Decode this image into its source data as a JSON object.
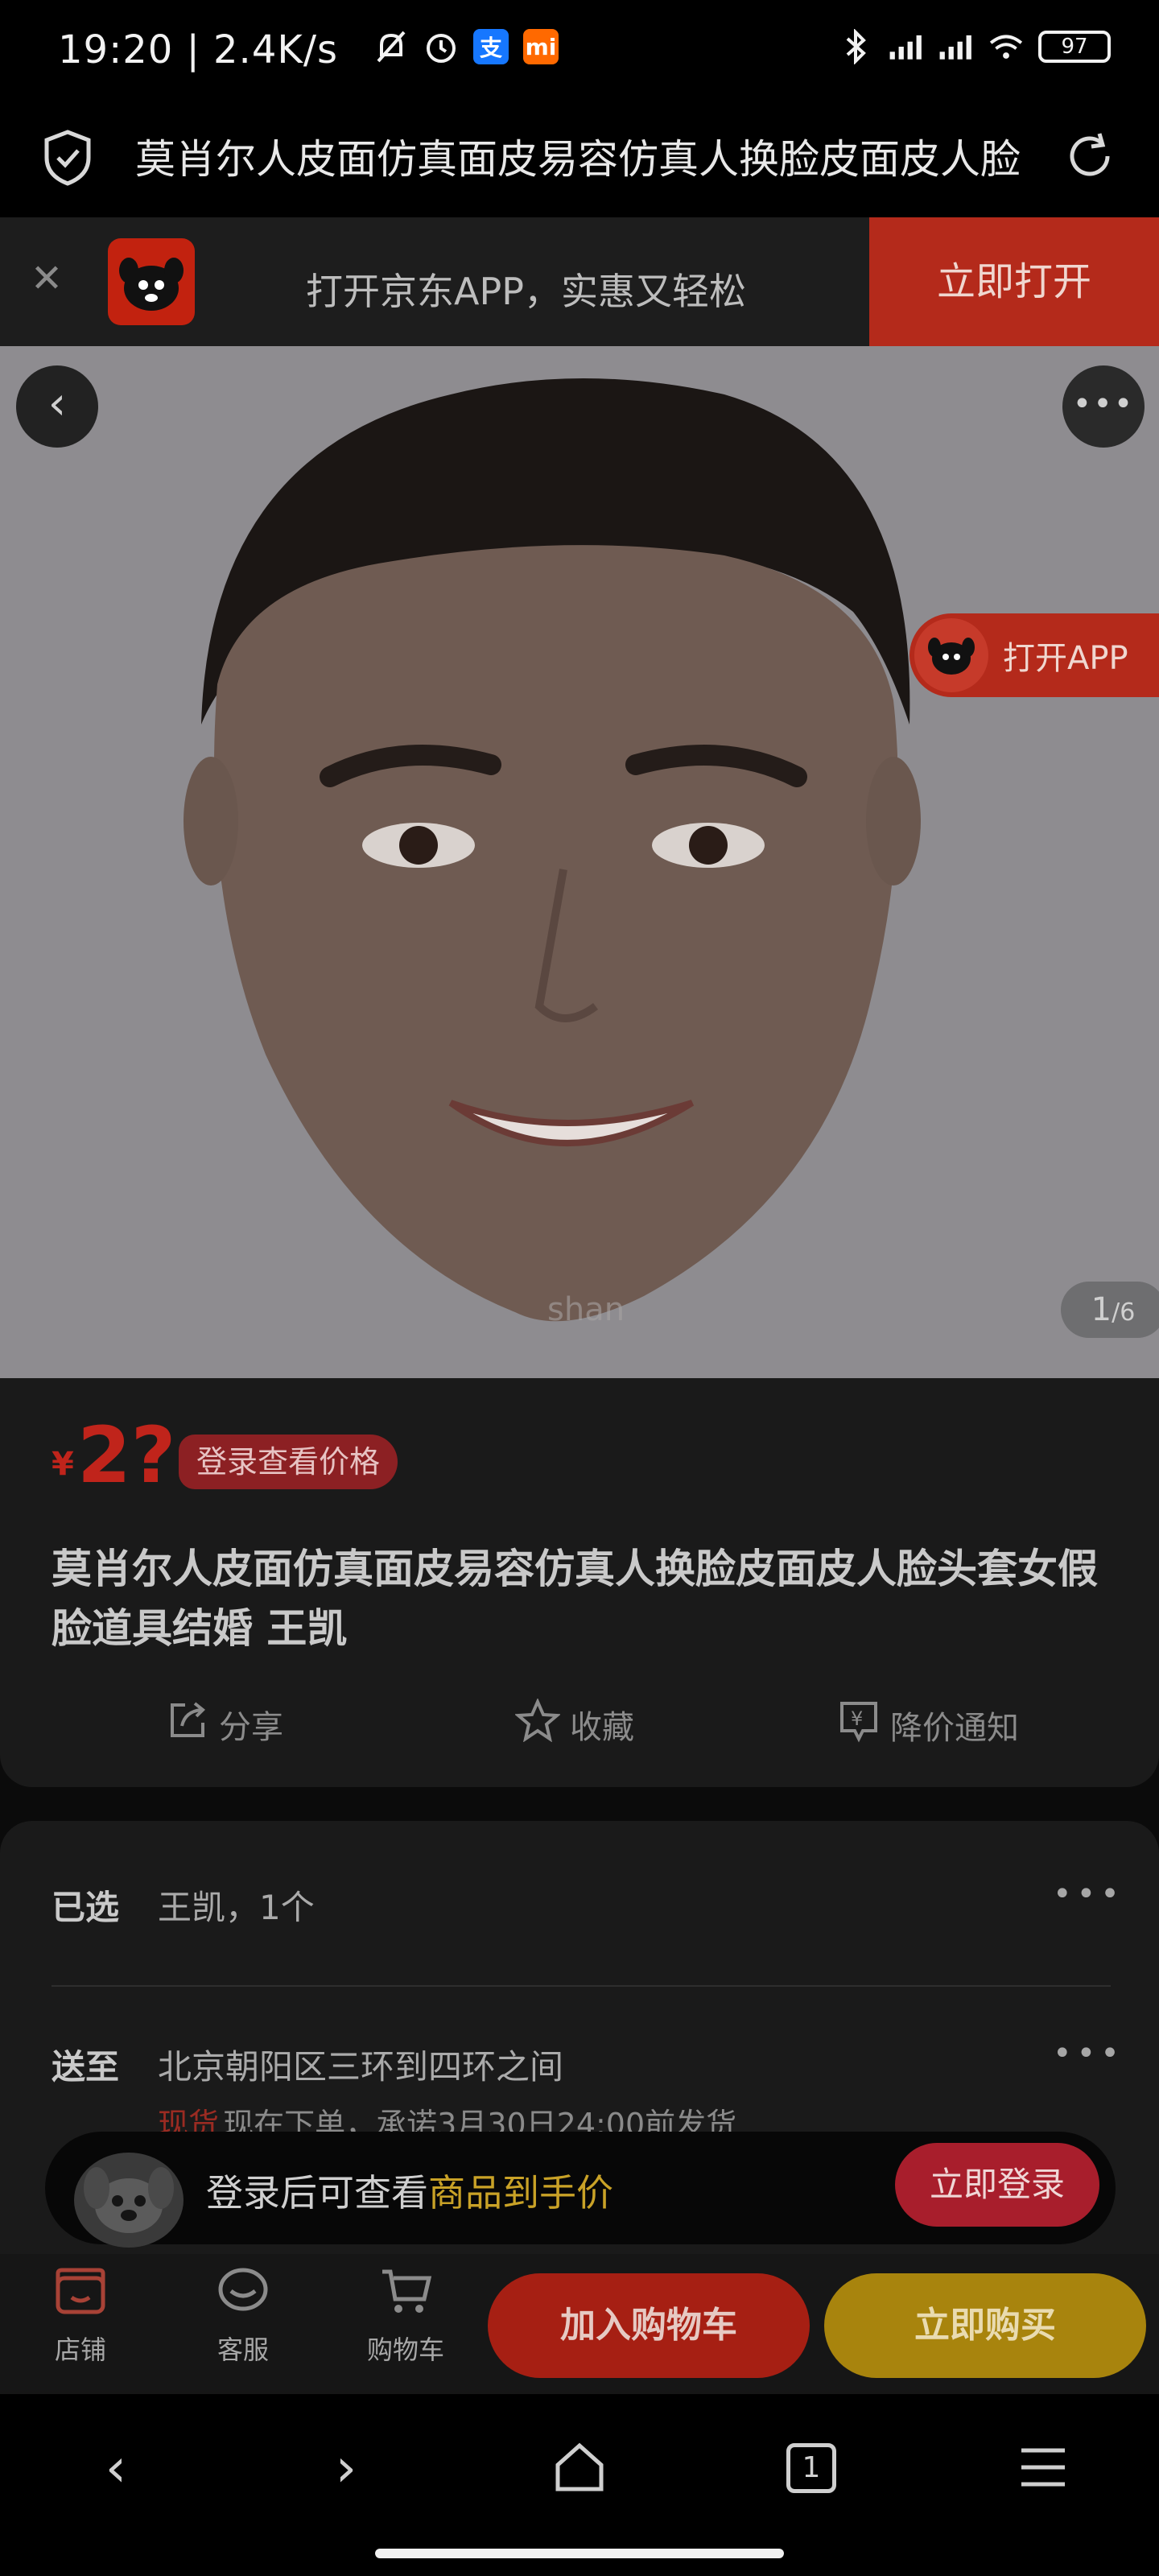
{
  "status_bar": {
    "time": "19:20 | 2.4K/s",
    "battery": "97"
  },
  "address_bar": {
    "title": "莫肖尔人皮面仿真面皮易容仿真人换脸皮面皮人脸头套女假脸道具结婚 王凯"
  },
  "app_banner": {
    "text": "打开京东APP，实惠又轻松",
    "button": "立即打开"
  },
  "image": {
    "open_app": "打开APP",
    "counter_current": "1",
    "counter_total": "/6"
  },
  "product": {
    "price_symbol": "¥",
    "price": "2?",
    "price_badge": "登录查看价格",
    "title": "莫肖尔人皮面仿真面皮易容仿真人换脸皮面皮人脸头套女假脸道具结婚 王凯",
    "actions": [
      {
        "label": "分享",
        "icon": "share-icon"
      },
      {
        "label": "收藏",
        "icon": "star-icon"
      },
      {
        "label": "降价通知",
        "icon": "price-drop-icon"
      }
    ]
  },
  "options": {
    "selected_label": "已选",
    "selected_value": "王凯，1个",
    "ship_label": "送至",
    "ship_value": "北京朝阳区三环到四环之间",
    "stock_tag": "现货",
    "stock_text": "现在下单，承诺3月30日24:00前发货"
  },
  "login_prompt": {
    "text": "登录后可查看",
    "highlight": "商品到手价",
    "button": "立即登录"
  },
  "bottom_bar": {
    "tabs": [
      {
        "label": "店铺",
        "icon": "store-icon"
      },
      {
        "label": "客服",
        "icon": "customer-service-icon"
      },
      {
        "label": "购物车",
        "icon": "cart-icon"
      }
    ],
    "add_to_cart": "加入购物车",
    "buy_now": "立即购买"
  },
  "browser_nav": {
    "tab_count": "1"
  },
  "colors": {
    "jd_red": "#b42a1b",
    "price_red": "#c0241b",
    "buy_gold": "#a8840d"
  }
}
